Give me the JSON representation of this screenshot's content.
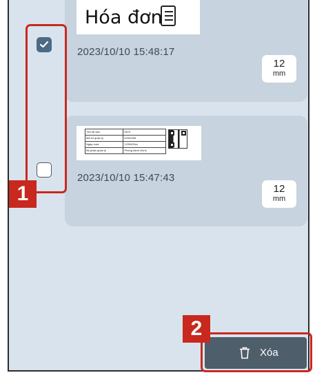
{
  "items": [
    {
      "thumb_title": "Hóa đơn",
      "timestamp": "2023/10/10 15:48:17",
      "size_value": "12",
      "size_unit": "mm",
      "checked": true
    },
    {
      "label_rows": [
        [
          "Tên tài sản",
          "5574"
        ],
        [
          "Mã số quản lý",
          "KG00206"
        ],
        [
          "Ngày mua",
          "12/05/20xx"
        ],
        [
          "Bộ phận quản lý",
          "Phòng hành chính"
        ]
      ],
      "timestamp": "2023/10/10 15:47:43",
      "size_value": "12",
      "size_unit": "mm",
      "checked": false
    }
  ],
  "callouts": {
    "one": "1",
    "two": "2"
  },
  "delete_button": {
    "label": "Xóa",
    "icon": "trash-icon"
  },
  "colors": {
    "panel": "#d9e3ed",
    "card": "#c7d3de",
    "accent": "#4b6a85",
    "highlight": "#c8281e",
    "button": "#4f5e6b"
  }
}
